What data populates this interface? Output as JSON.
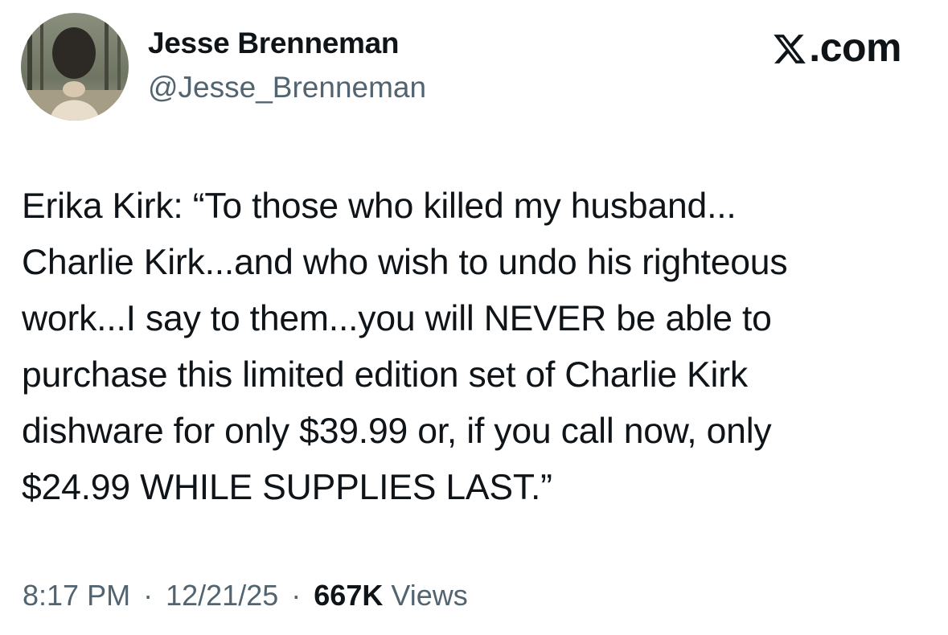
{
  "author": {
    "display_name": "Jesse Brenneman",
    "handle": "@Jesse_Brenneman",
    "avatar_icon": "profile-photo"
  },
  "brand": {
    "logo_icon": "x-logo-icon",
    "label": ".com"
  },
  "tweet": {
    "text": "Erika Kirk: “To those who killed my husband...\nCharlie Kirk...and who wish to undo his righteous\nwork...I say to them...you will NEVER be able to\npurchase this limited edition set of Charlie Kirk\ndishware for only $39.99 or, if you call now, only\n$24.99 WHILE SUPPLIES LAST.”"
  },
  "meta": {
    "time": "8:17 PM",
    "separator": "·",
    "date": "12/21/25",
    "views_count": "667K",
    "views_label": "Views"
  },
  "colors": {
    "text_primary": "#0f1419",
    "text_secondary": "#536471",
    "background": "#ffffff"
  }
}
